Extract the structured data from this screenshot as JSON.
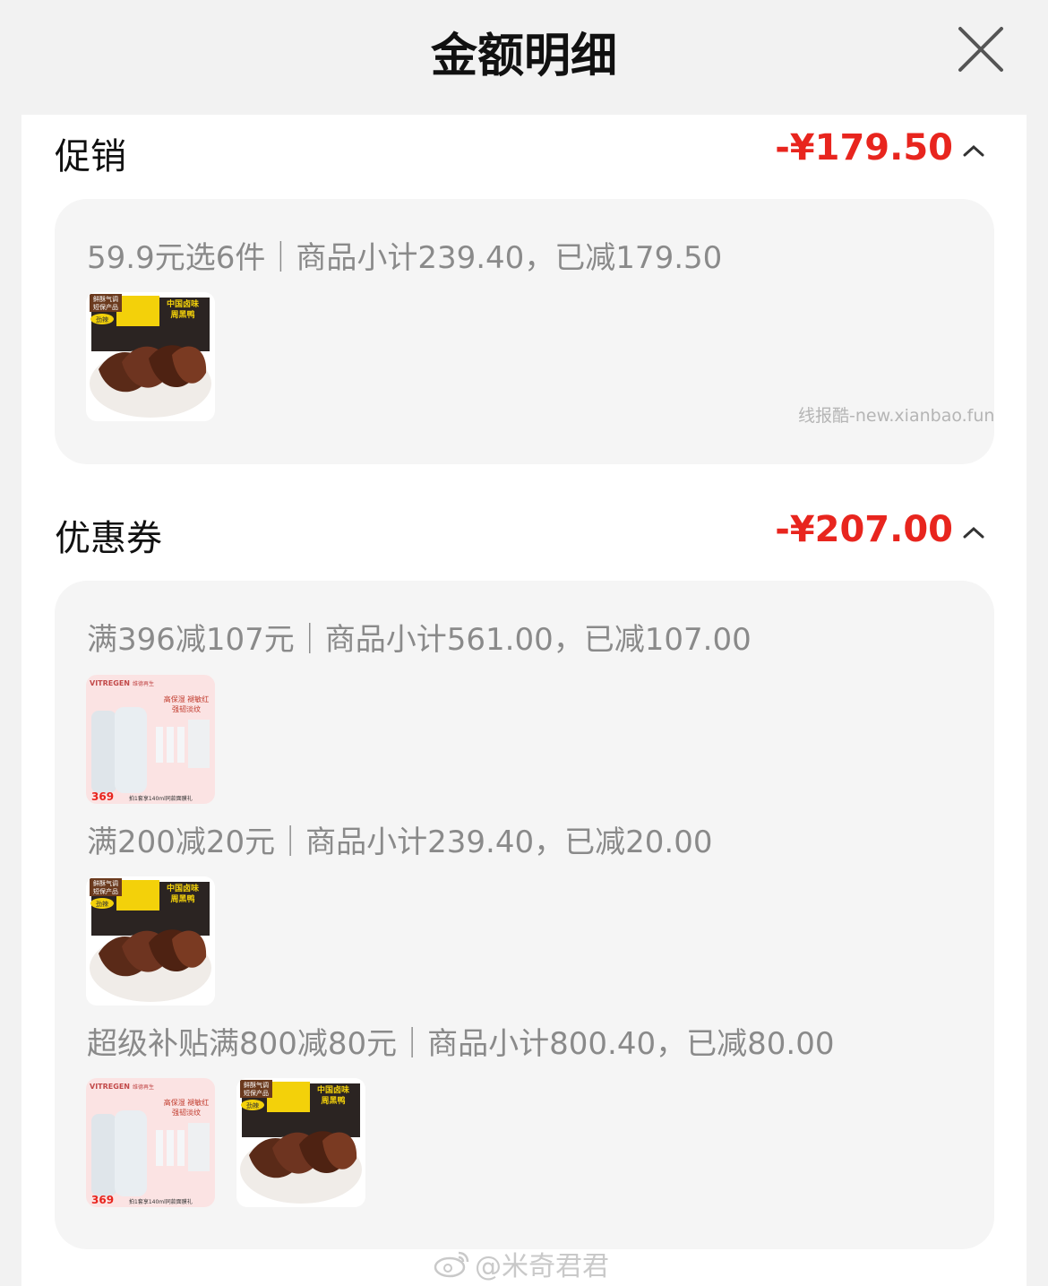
{
  "header": {
    "title": "金额明细",
    "close_icon": "close-icon"
  },
  "promotion": {
    "title": "促销",
    "amount": "-¥179.50",
    "rules": [
      {
        "text": "59.9元选6件｜商品小计239.40，已减179.50",
        "items": [
          "duck-product"
        ]
      }
    ]
  },
  "coupon": {
    "title": "优惠券",
    "amount": "-¥207.00",
    "rules": [
      {
        "text": "满396减107元｜商品小计561.00，已减107.00",
        "items": [
          "vitregen-product"
        ]
      },
      {
        "text": "满200减20元｜商品小计239.40，已减20.00",
        "items": [
          "duck-product"
        ]
      },
      {
        "text": "超级补贴满800减80元｜商品小计800.40，已减80.00",
        "items": [
          "vitregen-product",
          "duck-product"
        ]
      }
    ]
  },
  "products": {
    "duck": {
      "badge1": "鲜酥气调",
      "badge2": "短保产品",
      "badge3": "劲辣",
      "slogan1": "中国卤味",
      "slogan2": "周黑鸭"
    },
    "vitregen": {
      "brand": "VITREGEN",
      "brand_cn": "维德再生",
      "headline1": "高保湿 褪敏红",
      "headline2": "强韧淡纹",
      "price": "369",
      "promo": "拍1套享140ml同款面膜礼"
    }
  },
  "watermarks": {
    "site": "线报酷-new.xianbao.fun",
    "weibo": "@米奇君君"
  },
  "colors": {
    "accent": "#e8251e",
    "muted_text": "#8a8a8a",
    "card_bg": "#f5f5f5"
  }
}
